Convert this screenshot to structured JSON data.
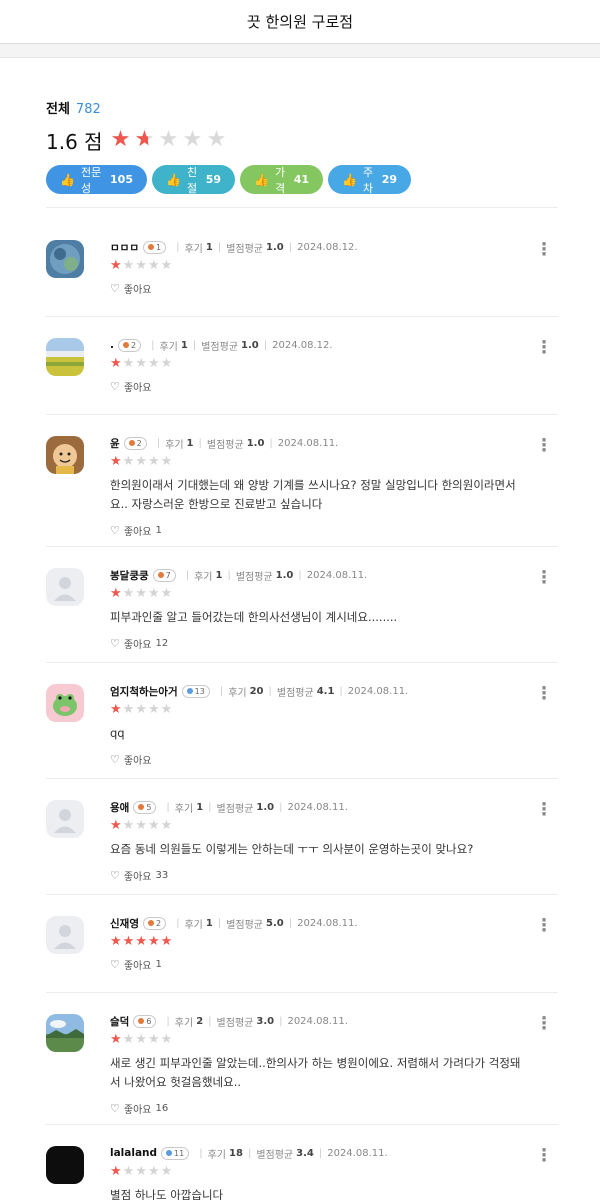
{
  "header": {
    "title": "끗 한의원 구로점"
  },
  "summary": {
    "total_label": "전체",
    "total_count": "782",
    "score_text": "1.6 점",
    "score": 1.6,
    "max_score": 5
  },
  "tags": [
    {
      "label": "전문성",
      "count": "105",
      "color": "#3f95e3",
      "icon": "thumbs-up-icon"
    },
    {
      "label": "친절",
      "count": "59",
      "color": "#3fb3c9",
      "icon": "thumbs-up-icon"
    },
    {
      "label": "가격",
      "count": "41",
      "color": "#84c761",
      "icon": "thumbs-up-icon"
    },
    {
      "label": "주차",
      "count": "29",
      "color": "#48a8e6",
      "icon": "thumbs-up-icon"
    }
  ],
  "labels": {
    "reviews_label": "후기",
    "avg_label": "별점평균",
    "like_label": "좋아요"
  },
  "reviews": [
    {
      "nick": "ㅁㅁㅁ",
      "level": "1",
      "reviews": "1",
      "avg": "1.0",
      "date": "2024.08.12.",
      "rating": 1,
      "text": "",
      "likes": "",
      "avatar": "blue-photo"
    },
    {
      "nick": ".",
      "level": "2",
      "reviews": "1",
      "avg": "1.0",
      "date": "2024.08.12.",
      "rating": 1,
      "text": "",
      "likes": "",
      "avatar": "field-photo"
    },
    {
      "nick": "윤",
      "level": "2",
      "reviews": "1",
      "avg": "1.0",
      "date": "2024.08.11.",
      "rating": 1,
      "text": "한의원이래서 기대했는데 왜 양방 기계를 쓰시나요? 정말 실망입니다 한의원이라면서요.. 자랑스러운 한방으로 진료받고 싶습니다",
      "likes": "1",
      "avatar": "cartoon"
    },
    {
      "nick": "봉달쿵쿵",
      "level": "7",
      "reviews": "1",
      "avg": "1.0",
      "date": "2024.08.11.",
      "rating": 1,
      "text": "피부과인줄 알고 들어갔는데 한의사선생님이 계시네요........",
      "likes": "12",
      "avatar": "default"
    },
    {
      "nick": "엄지척하는아거",
      "level": "13",
      "reviews": "20",
      "avg": "4.1",
      "date": "2024.08.11.",
      "rating": 1,
      "text": "qq",
      "likes": "",
      "avatar": "frog"
    },
    {
      "nick": "용애",
      "level": "5",
      "reviews": "1",
      "avg": "1.0",
      "date": "2024.08.11.",
      "rating": 1,
      "text": "요즘 동네 의원들도 이렇게는 안하는데 ㅜㅜ 의사분이 운영하는곳이 맞나요?",
      "likes": "33",
      "avatar": "default"
    },
    {
      "nick": "신재영",
      "level": "2",
      "reviews": "1",
      "avg": "5.0",
      "date": "2024.08.11.",
      "rating": 5,
      "text": "",
      "likes": "1",
      "avatar": "default"
    },
    {
      "nick": "슬덕",
      "level": "6",
      "reviews": "2",
      "avg": "3.0",
      "date": "2024.08.11.",
      "rating": 1,
      "text": "새로 생긴 피부과인줄 알았는데..한의사가 하는 병원이에요. 저렴해서 가려다가 걱정돼서 나왔어요 헛걸음했네요..",
      "likes": "16",
      "avatar": "landscape"
    },
    {
      "nick": "lalaland",
      "level": "11",
      "reviews": "18",
      "avg": "3.4",
      "date": "2024.08.11.",
      "rating": 1,
      "text": "별점 하나도 아깝습니다",
      "likes": "",
      "avatar": "black"
    }
  ]
}
